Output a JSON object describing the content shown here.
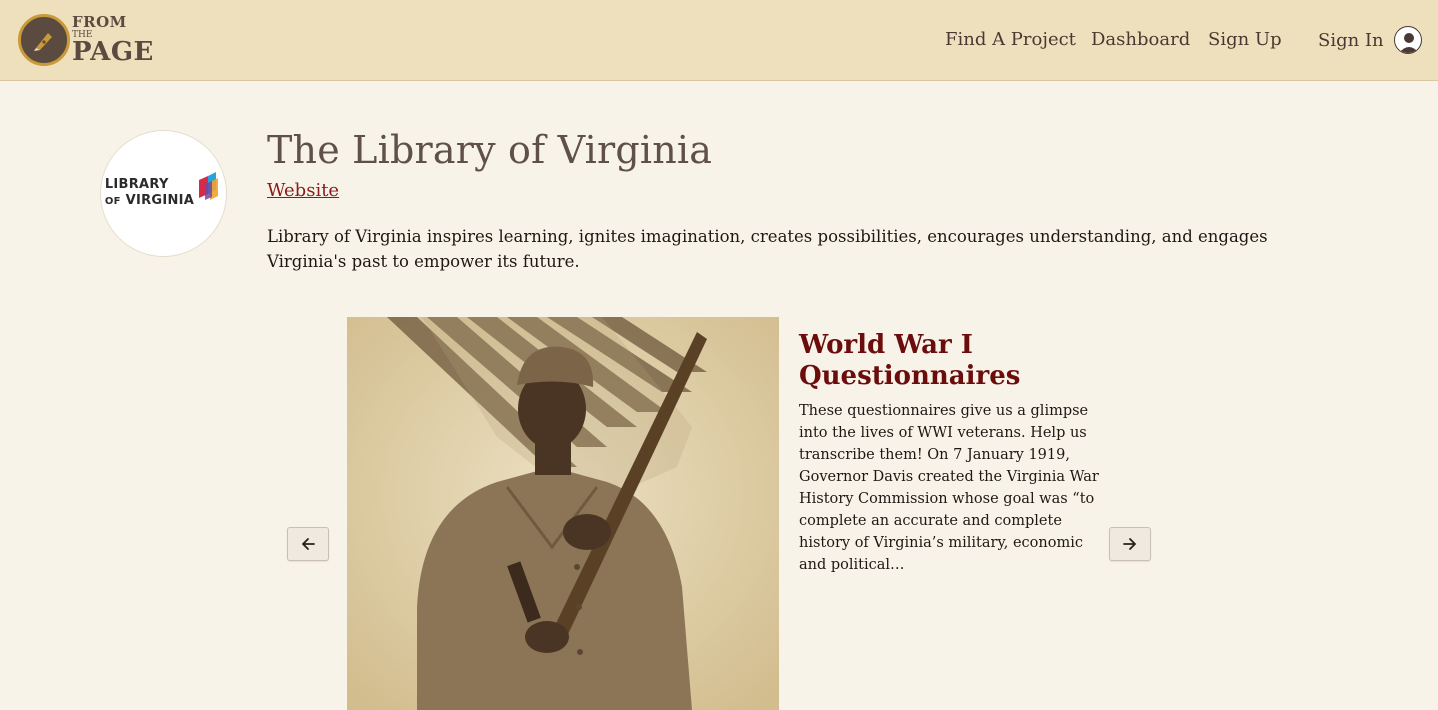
{
  "header": {
    "logo": {
      "from": "FROM",
      "the": "THE",
      "page": "PAGE"
    },
    "nav": {
      "find_project": "Find A Project",
      "dashboard": "Dashboard",
      "sign_up": "Sign Up",
      "sign_in": "Sign In"
    }
  },
  "org": {
    "logo_line1": "LIBRARY",
    "logo_line2_small": "OF",
    "logo_line2": "VIRGINIA",
    "title": "The Library of Virginia",
    "website_label": "Website",
    "description": "Library of Virginia inspires learning, ignites imagination, creates possibilities, encourages understanding, and engages Virginia's past to empower its future."
  },
  "carousel": {
    "prev_icon": "arrow-left-icon",
    "next_icon": "arrow-right-icon",
    "project": {
      "title": "World War I Questionnaires",
      "description": "These questionnaires give us a glimpse into the lives of WWI veterans. Help us transcribe them! On 7 January 1919, Governor Davis created the Virginia War History Commission whose goal was “to complete an accurate and complete history of Virginia’s military, economic and political…"
    }
  },
  "colors": {
    "header_bg": "#efe0bd",
    "page_bg": "#f8f3e8",
    "accent_dark_red": "#6b0d0d",
    "link_red": "#8a1a1a"
  }
}
